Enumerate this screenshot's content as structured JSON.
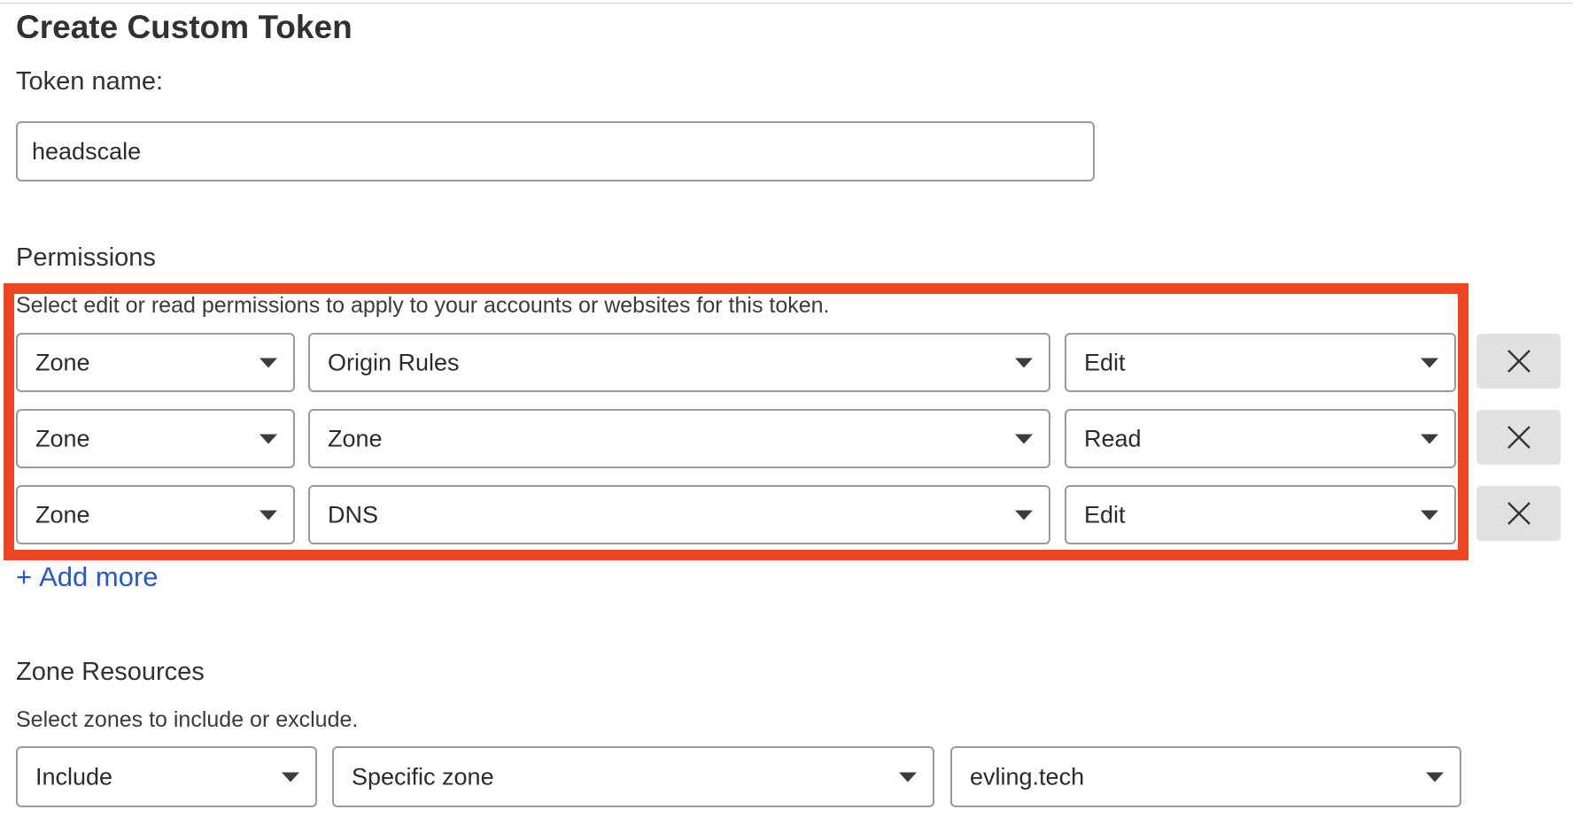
{
  "page_title": "Create Custom Token",
  "token_name": {
    "label": "Token name:",
    "value": "headscale"
  },
  "permissions": {
    "heading": "Permissions",
    "description": "Select edit or read permissions to apply to your accounts or websites for this token.",
    "rows": [
      {
        "scope": "Zone",
        "resource": "Origin Rules",
        "access": "Edit"
      },
      {
        "scope": "Zone",
        "resource": "Zone",
        "access": "Read"
      },
      {
        "scope": "Zone",
        "resource": "DNS",
        "access": "Edit"
      }
    ],
    "add_more_plus": "+",
    "add_more_label": "Add more",
    "highlight_color": "#ee4522"
  },
  "zone_resources": {
    "heading": "Zone Resources",
    "description": "Select zones to include or exclude.",
    "mode": "Include",
    "target": "Specific zone",
    "zone": "evling.tech"
  },
  "colors": {
    "link": "#2459c9",
    "highlight": "#ee4522",
    "remove_button_bg": "#e1e1e1"
  },
  "icons": {
    "caret": "caret-down-icon",
    "remove": "close-icon"
  }
}
